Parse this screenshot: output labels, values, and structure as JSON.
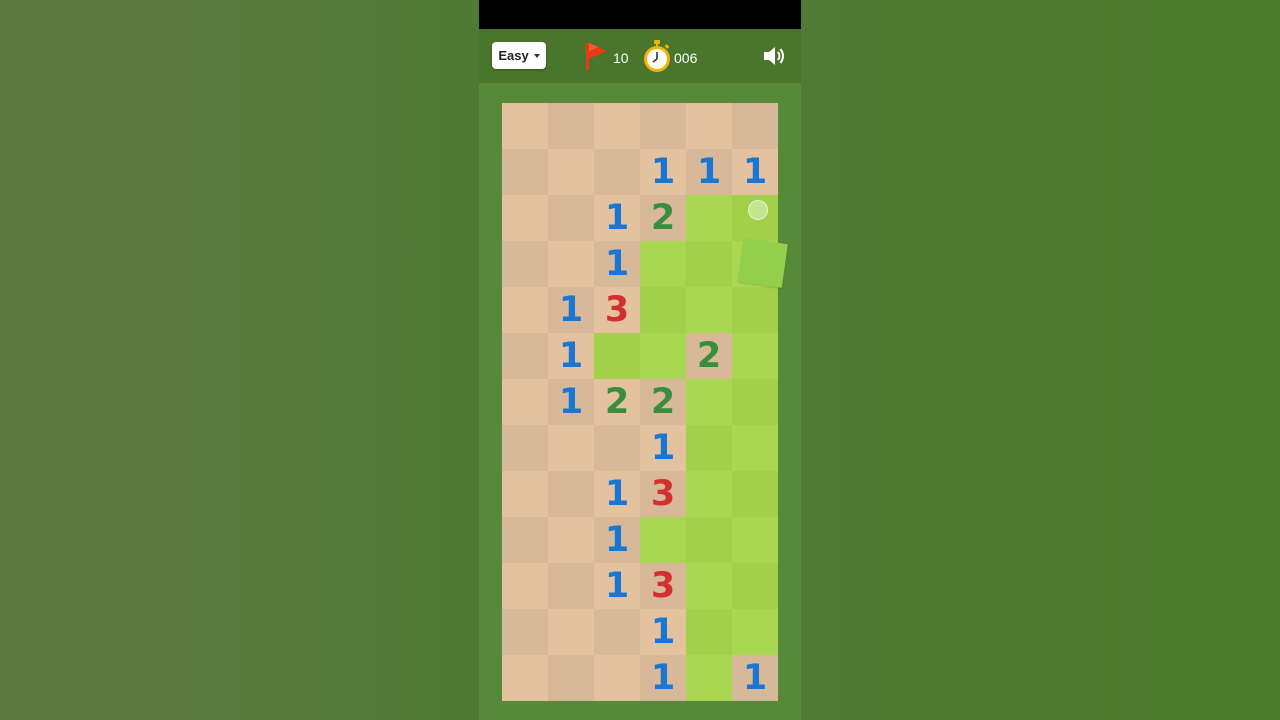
{
  "header": {
    "difficulty": "Easy",
    "flags_remaining": "10",
    "timer": "006"
  },
  "board": {
    "cols": 6,
    "rows": 13,
    "cells": [
      "UUUUUU",
      "UUU111",
      "UU12GG",
      "UU1GGG",
      "U13GGG",
      "U1GG2G",
      "U122GG",
      "UUU1GG",
      "UU13GG",
      "UU1GGG",
      "UU13GG",
      "UUU1GG",
      "UUU1G1"
    ]
  },
  "colors": {
    "revealed_light": "#e5c29f",
    "revealed_dark": "#d7b899",
    "hidden_light": "#aad751",
    "hidden_dark": "#a2d149",
    "number_1": "#1976d2",
    "number_2": "#388e3c",
    "number_3": "#d32f2f",
    "header_bg": "#4a752c",
    "flag": "#e53c17",
    "timer": "#f5b400"
  }
}
